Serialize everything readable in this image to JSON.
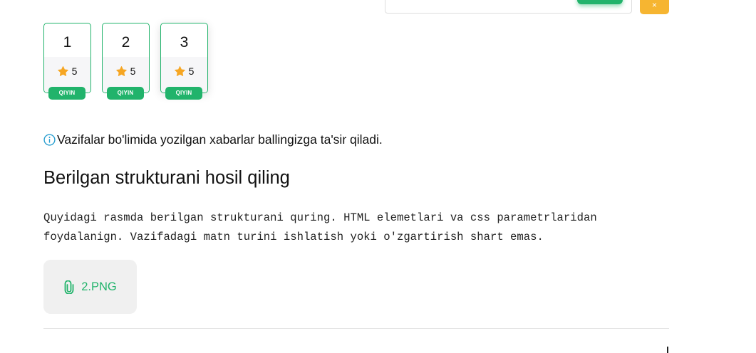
{
  "header": {
    "orange_button_icon": "x-icon",
    "orange_button_glyph": "×"
  },
  "tasks": [
    {
      "number": "1",
      "score": "5",
      "difficulty": "QIYIN"
    },
    {
      "number": "2",
      "score": "5",
      "difficulty": "QIYIN"
    },
    {
      "number": "3",
      "score": "5",
      "difficulty": "QIYIN"
    }
  ],
  "info": {
    "icon": "info-icon",
    "text": "Vazifalar bo'limida yozilgan xabarlar ballingizga ta'sir qiladi."
  },
  "task": {
    "title": "Berilgan strukturani hosil qiling",
    "description": "Quyidagi rasmda berilgan strukturani quring. HTML elemetlari va css parametrlaridan foydalanign. Vazifadagi matn turini ishlatish yoki o'zgartirish shart emas.",
    "attachment": {
      "icon": "paperclip-icon",
      "label": "2.PNG"
    }
  },
  "colors": {
    "accent_green": "#21b36b",
    "orange": "#f6b531",
    "star": "#f6a623",
    "info_icon": "#2a9fd0"
  }
}
